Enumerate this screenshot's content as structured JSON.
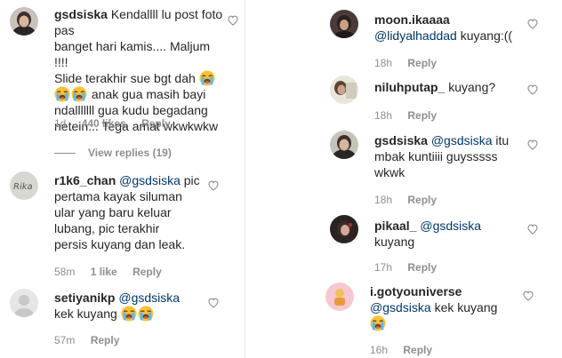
{
  "comments_left": [
    {
      "username": "gsdsiska",
      "text_lines": [
        "Kendallll lu post foto pas",
        "banget hari kamis.... Maljum !!!!",
        "Slide terakhir sue bgt dah",
        "anak gua masih bayi",
        "ndalllllll gua kudu begadang",
        "netein... Tega amat wkwkwkw"
      ],
      "time": "1d",
      "likes": "440 likes",
      "reply": "Reply",
      "view_replies": "View replies (19)"
    },
    {
      "username": "r1k6_chan",
      "mention": "@gsdsiska",
      "text_lines": [
        "pic",
        "pertama kayak siluman",
        "ular yang baru keluar",
        "lubang, pic terakhir",
        "persis kuyang dan leak."
      ],
      "time": "58m",
      "likes": "1 like",
      "reply": "Reply"
    },
    {
      "username": "setiyanikp",
      "mention": "@gsdsiska",
      "text": "kek kuyang",
      "time": "57m",
      "reply": "Reply"
    }
  ],
  "comments_right": [
    {
      "username": "moon.ikaaaa",
      "mention": "@lidyalhaddad",
      "text": "kuyang:((",
      "time": "18h",
      "reply": "Reply"
    },
    {
      "username": "niluhputap_",
      "text": "kuyang?",
      "time": "18h",
      "reply": "Reply"
    },
    {
      "username": "gsdsiska",
      "mention": "@gsdsiska",
      "text_lines": [
        "itu",
        "mbak kuntiiii guysssss",
        "wkwk"
      ],
      "time": "18h",
      "reply": "Reply"
    },
    {
      "username": "pikaal_",
      "mention": "@gsdsiska",
      "text": "kuyang",
      "time": "17h",
      "reply": "Reply"
    },
    {
      "username": "i.gotyouniverse",
      "mention": "@gsdsiska",
      "text": "kek kuyang",
      "time": "16h",
      "reply": "Reply"
    }
  ],
  "icons": {
    "like": "heart-icon",
    "emoji": "loudly-crying-face-emoji"
  },
  "colors": {
    "text": "#262626",
    "meta": "#8e8e8e",
    "mention": "#00376b",
    "divider": "#e6e6e6"
  }
}
